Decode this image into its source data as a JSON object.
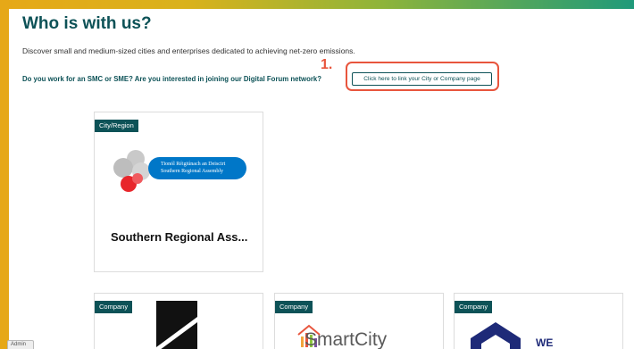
{
  "page": {
    "title": "Who is with us?",
    "description": "Discover small and medium-sized cities and enterprises dedicated to achieving net-zero emissions.",
    "question": "Do you work for an SMC or SME? Are you interested in joining our Digital Forum network?",
    "link_button": "Click here to link your City or Company page",
    "annotation_step": "1."
  },
  "cards": [
    {
      "badge": "City/Region",
      "title": "Southern Regional Ass...",
      "logo_line1": "Tionól Réigiúnach an Deiscirt",
      "logo_line2": "Southern Regional Assembly"
    },
    {
      "badge": "Company",
      "logo_text": ""
    },
    {
      "badge": "Company",
      "logo_text": "SmartCity"
    },
    {
      "badge": "Company",
      "logo_text": "WE"
    }
  ],
  "admin": {
    "label": "Admin"
  },
  "colors": {
    "brand": "#0d5257",
    "annotation": "#e8553d",
    "logo_blue": "#0077c8"
  }
}
